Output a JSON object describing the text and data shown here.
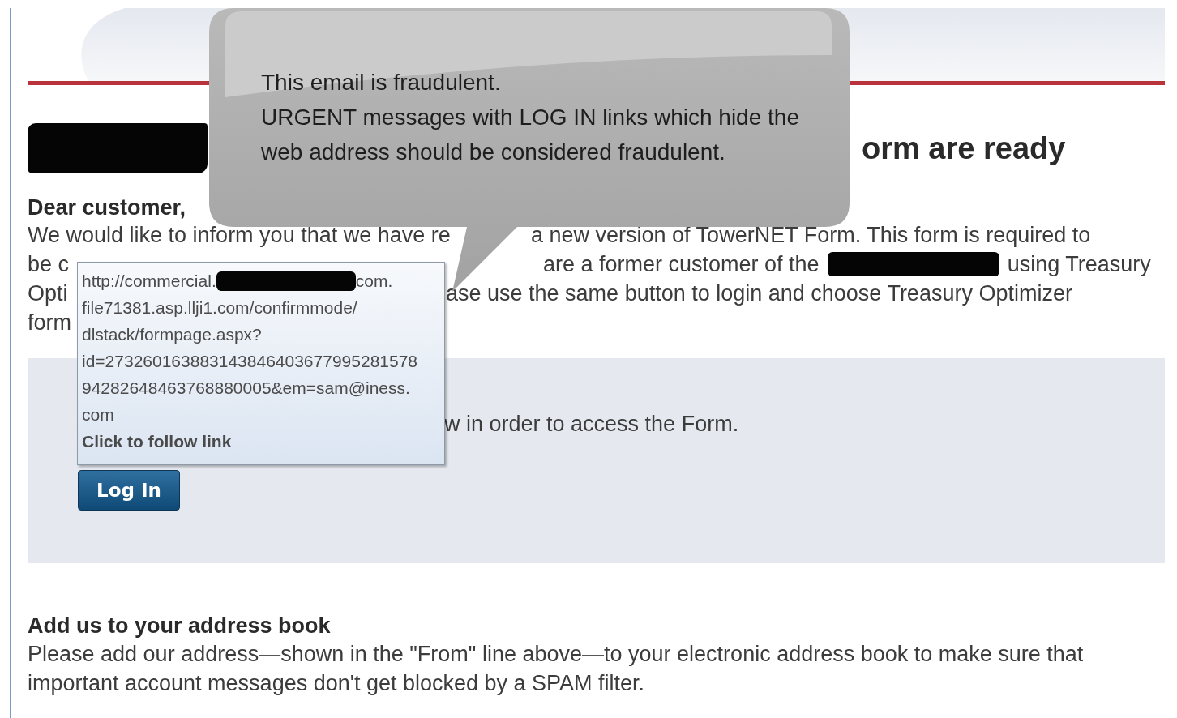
{
  "heading": {
    "segments": [
      {
        "kind": "redacted"
      },
      {
        "kind": "text",
        "text": "orm are ready"
      }
    ]
  },
  "greeting": "Dear customer,",
  "intro_lines": [
    [
      {
        "kind": "text",
        "text": "We would like to inform you that we have re"
      },
      {
        "kind": "text",
        "text": "a new version of TowerNET Form. This form is required to"
      }
    ],
    [
      {
        "kind": "text",
        "text": "be c"
      },
      {
        "kind": "text",
        "text": "are a former customer of the"
      },
      {
        "kind": "redacted"
      },
      {
        "kind": "text",
        "text": "using Treasury"
      }
    ],
    [
      {
        "kind": "text",
        "text": "Opti"
      },
      {
        "kind": "text",
        "text": "ase use the same button to login and choose Treasury Optimizer"
      }
    ],
    [
      {
        "kind": "text",
        "text": "form"
      }
    ]
  ],
  "login_panel": {
    "instruction": "w in order to access the Form.",
    "button": "Log In"
  },
  "address_book": {
    "title": "Add us to your address book",
    "text": "Please add our address—shown in the \"From\" line above—to your electronic address book to make sure that important account messages don't get blocked by a SPAM filter."
  },
  "callout": {
    "lines": [
      "This email is fraudulent.",
      "URGENT messages with LOG IN links which hide the",
      "web address should be considered fraudulent."
    ]
  },
  "tooltip": {
    "url_lines": [
      [
        {
          "kind": "text",
          "text": "http://commercial."
        },
        {
          "kind": "redacted"
        },
        {
          "kind": "text",
          "text": "com."
        }
      ],
      [
        {
          "kind": "text",
          "text": "file71381.asp.llji1.com/confirmmode/"
        }
      ],
      [
        {
          "kind": "text",
          "text": "dlstack/formpage.aspx?"
        }
      ],
      [
        {
          "kind": "text",
          "text": "id=273260163883143846403677995281578"
        }
      ],
      [
        {
          "kind": "text",
          "text": "94282648463768880005&em=sam@iness."
        }
      ],
      [
        {
          "kind": "text",
          "text": "com"
        }
      ]
    ],
    "action": "Click to follow link"
  }
}
